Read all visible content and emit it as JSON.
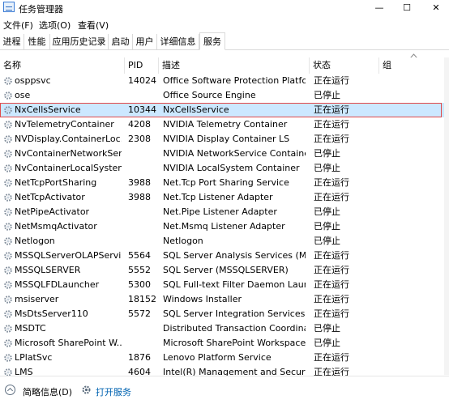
{
  "window": {
    "title": "任务管理器",
    "minimize": "—",
    "maximize": "☐",
    "close": "✕"
  },
  "menu": [
    "文件(F)",
    "选项(O)",
    "查看(V)"
  ],
  "tabs": [
    "进程",
    "性能",
    "应用历史记录",
    "启动",
    "用户",
    "详细信息",
    "服务"
  ],
  "active_tab": "服务",
  "columns": {
    "name": "名称",
    "pid": "PID",
    "desc": "描述",
    "status": "状态",
    "group": "组"
  },
  "rows": [
    {
      "name": "osppsvc",
      "pid": "14024",
      "desc": "Office Software Protection Platfo",
      "status": "正在运行"
    },
    {
      "name": "ose",
      "pid": "",
      "desc": "Office  Source Engine",
      "status": "已停止"
    },
    {
      "name": "NxCellsService",
      "pid": "10344",
      "desc": "NxCellsService",
      "status": "正在运行",
      "selected": true
    },
    {
      "name": "NvTelemetryContainer",
      "pid": "4208",
      "desc": "NVIDIA Telemetry Container",
      "status": "正在运行"
    },
    {
      "name": "NVDisplay.ContainerLoc...",
      "pid": "2308",
      "desc": "NVIDIA Display Container LS",
      "status": "正在运行"
    },
    {
      "name": "NvContainerNetworkSer...",
      "pid": "",
      "desc": "NVIDIA NetworkService Container",
      "status": "已停止"
    },
    {
      "name": "NvContainerLocalSystem",
      "pid": "",
      "desc": "NVIDIA LocalSystem Container",
      "status": "已停止"
    },
    {
      "name": "NetTcpPortSharing",
      "pid": "3988",
      "desc": "Net.Tcp Port Sharing Service",
      "status": "正在运行"
    },
    {
      "name": "NetTcpActivator",
      "pid": "3988",
      "desc": "Net.Tcp Listener Adapter",
      "status": "正在运行"
    },
    {
      "name": "NetPipeActivator",
      "pid": "",
      "desc": "Net.Pipe Listener Adapter",
      "status": "已停止"
    },
    {
      "name": "NetMsmqActivator",
      "pid": "",
      "desc": "Net.Msmq Listener Adapter",
      "status": "已停止"
    },
    {
      "name": "Netlogon",
      "pid": "",
      "desc": "Netlogon",
      "status": "已停止"
    },
    {
      "name": "MSSQLServerOLAPService",
      "pid": "5564",
      "desc": "SQL Server Analysis Services (MS...",
      "status": "正在运行"
    },
    {
      "name": "MSSQLSERVER",
      "pid": "5552",
      "desc": "SQL Server (MSSQLSERVER)",
      "status": "正在运行"
    },
    {
      "name": "MSSQLFDLauncher",
      "pid": "5300",
      "desc": "SQL Full-text Filter Daemon Laun...",
      "status": "正在运行"
    },
    {
      "name": "msiserver",
      "pid": "18152",
      "desc": "Windows Installer",
      "status": "正在运行"
    },
    {
      "name": "MsDtsServer110",
      "pid": "5572",
      "desc": "SQL Server Integration Services ...",
      "status": "正在运行"
    },
    {
      "name": "MSDTC",
      "pid": "",
      "desc": "Distributed Transaction Coordina",
      "status": "已停止"
    },
    {
      "name": "Microsoft SharePoint W...",
      "pid": "",
      "desc": "Microsoft SharePoint Workspace...",
      "status": "已停止"
    },
    {
      "name": "LPlatSvc",
      "pid": "1876",
      "desc": "Lenovo Platform Service",
      "status": "正在运行"
    },
    {
      "name": "LMS",
      "pid": "4604",
      "desc": "Intel(R) Management and Securit",
      "status": "正在运行"
    }
  ],
  "footer": {
    "fewer_details": "简略信息(D)",
    "open_services": "打开服务"
  },
  "colors": {
    "selected_row": "#cce8ff",
    "highlight_border": "#e04a4a",
    "link": "#0063b1"
  }
}
